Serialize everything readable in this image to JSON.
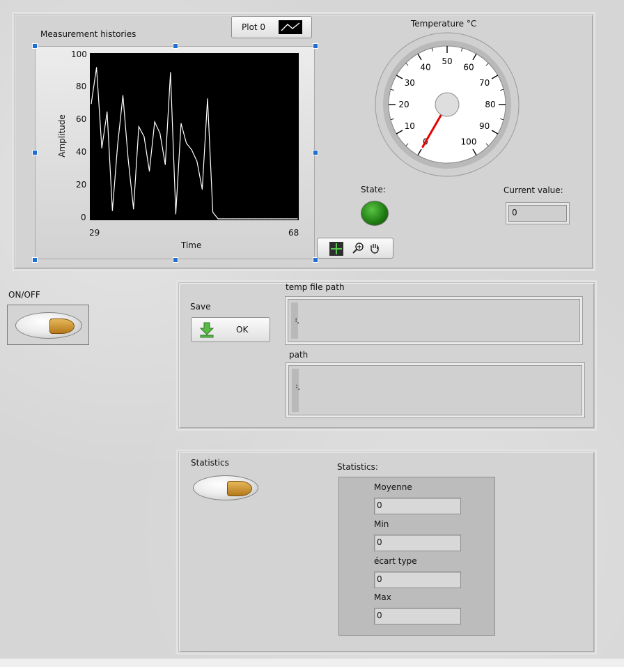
{
  "graph": {
    "title": "Measurement histories",
    "legend_label": "Plot 0",
    "ylabel": "Amplitude",
    "xlabel": "Time",
    "x_ticks": [
      "29",
      "68"
    ],
    "y_ticks": [
      "100",
      "80",
      "60",
      "40",
      "20",
      "0"
    ],
    "plot_bg": "#000000",
    "trace_color": "#ffffff"
  },
  "chart_data": {
    "type": "line",
    "xlim": [
      29,
      68
    ],
    "ylim": [
      0,
      100
    ],
    "x": [
      29,
      30,
      31,
      32,
      33,
      34,
      35,
      36,
      37,
      38,
      39,
      40,
      41,
      42,
      43,
      44,
      45,
      46,
      47,
      48,
      49,
      50,
      51,
      52,
      53,
      54,
      55,
      56,
      57,
      58,
      59,
      60,
      61,
      62,
      63,
      64,
      65,
      66,
      67,
      68
    ],
    "values": [
      70,
      92,
      43,
      65,
      5,
      45,
      75,
      36,
      6,
      56,
      50,
      29,
      59,
      52,
      33,
      89,
      3,
      58,
      46,
      42,
      35,
      18,
      73,
      4,
      0,
      0,
      0,
      0,
      0,
      0,
      0,
      0,
      0,
      0,
      0,
      0,
      0,
      0,
      0,
      0
    ]
  },
  "gauge": {
    "title": "Temperature °C",
    "ticks": [
      "0",
      "10",
      "20",
      "30",
      "40",
      "50",
      "60",
      "70",
      "80",
      "90",
      "100"
    ],
    "value": 0,
    "needle_color": "#e60000"
  },
  "state": {
    "label": "State:",
    "led_color": "#1e7a12"
  },
  "current": {
    "label": "Current value:",
    "value": "0"
  },
  "onoff": {
    "label": "ON/OFF"
  },
  "save": {
    "label": "Save",
    "ok_label": "OK"
  },
  "temp_path": {
    "label": "temp file path"
  },
  "path": {
    "label": "path"
  },
  "stats_toggle": {
    "label": "Statistics"
  },
  "stats": {
    "label": "Statistics:",
    "fields": [
      {
        "label": "Moyenne",
        "value": "0"
      },
      {
        "label": "Min",
        "value": "0"
      },
      {
        "label": "écart type",
        "value": "0"
      },
      {
        "label": "Max",
        "value": "0"
      }
    ]
  }
}
